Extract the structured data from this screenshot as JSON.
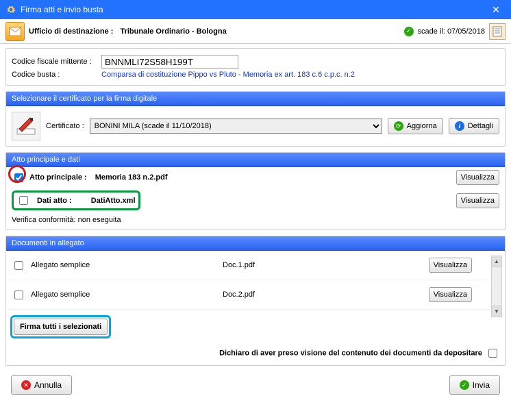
{
  "window": {
    "title": "Firma atti e invio busta"
  },
  "header": {
    "dest_label": "Ufficio di destinazione :",
    "dest_value": "Tribunale Ordinario - Bologna",
    "expiry_text": "scade il: 07/05/2018"
  },
  "mittente": {
    "cf_label": "Codice fiscale mittente :",
    "cf_value": "BNNMLI72S58H199T",
    "busta_label": "Codice  busta :",
    "busta_value": "Comparsa di costituzione Pippo vs Pluto - Memoria ex art. 183 c.6 c.p.c. n.2"
  },
  "cert": {
    "section_title": "Selezionare il certificato per la firma digitale",
    "label": "Certificato :",
    "selected": "BONINI MILA (scade il 11/10/2018)",
    "refresh": "Aggiorna",
    "details": "Dettagli"
  },
  "atti": {
    "section_title": "Atto principale e dati",
    "atto_label": "Atto principale :",
    "atto_value": "Memoria 183 n.2.pdf",
    "dati_label": "Dati atto :",
    "dati_value": "DatiAtto.xml",
    "visualizza": "Visualizza",
    "verifica": "Verifica conformità: non eseguita"
  },
  "docs": {
    "section_title": "Documenti in allegato",
    "type_label": "Allegato semplice",
    "visualizza": "Visualizza",
    "rows": [
      {
        "type": "Allegato semplice",
        "name": "Doc.1.pdf"
      },
      {
        "type": "Allegato semplice",
        "name": "Doc.2.pdf"
      }
    ],
    "sign_all": "Firma tutti i selezionati",
    "declare": "Dichiaro di aver preso visione del contenuto dei documenti da depositare"
  },
  "footer": {
    "cancel": "Annulla",
    "send": "Invia"
  }
}
